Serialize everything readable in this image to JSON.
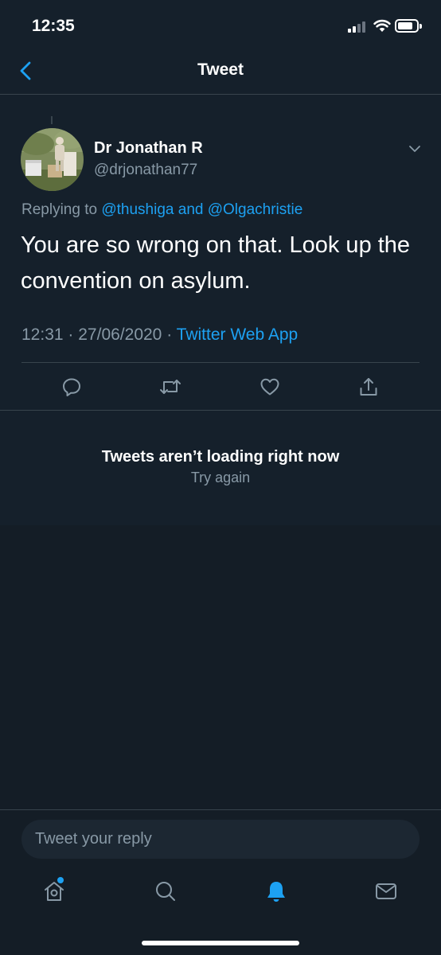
{
  "status_bar": {
    "time": "12:35"
  },
  "header": {
    "title": "Tweet",
    "back_icon": "chevron-left-icon"
  },
  "tweet": {
    "author_name": "Dr Jonathan R",
    "author_handle": "@drjonathan77",
    "replying_prefix": "Replying to",
    "mention_1": "@thushiga",
    "mention_joiner": "and",
    "mention_2": "@Olgachristie",
    "text": "You are so wrong on that. Look up the convention on asylum.",
    "time": "12:31",
    "date": "27/06/2020",
    "separator": "·",
    "source": "Twitter Web App",
    "actions": [
      "reply-icon",
      "retweet-icon",
      "like-icon",
      "share-icon"
    ]
  },
  "error": {
    "title": "Tweets aren’t loading right now",
    "retry": "Try again"
  },
  "reply": {
    "placeholder": "Tweet your reply"
  },
  "tab_bar": {
    "items": [
      "home-icon",
      "search-icon",
      "notifications-icon",
      "messages-icon"
    ],
    "active": "notifications-icon"
  },
  "colors": {
    "accent": "#1da1f2",
    "background": "#15202b",
    "secondary_text": "#8899a6",
    "border": "#38444d"
  }
}
